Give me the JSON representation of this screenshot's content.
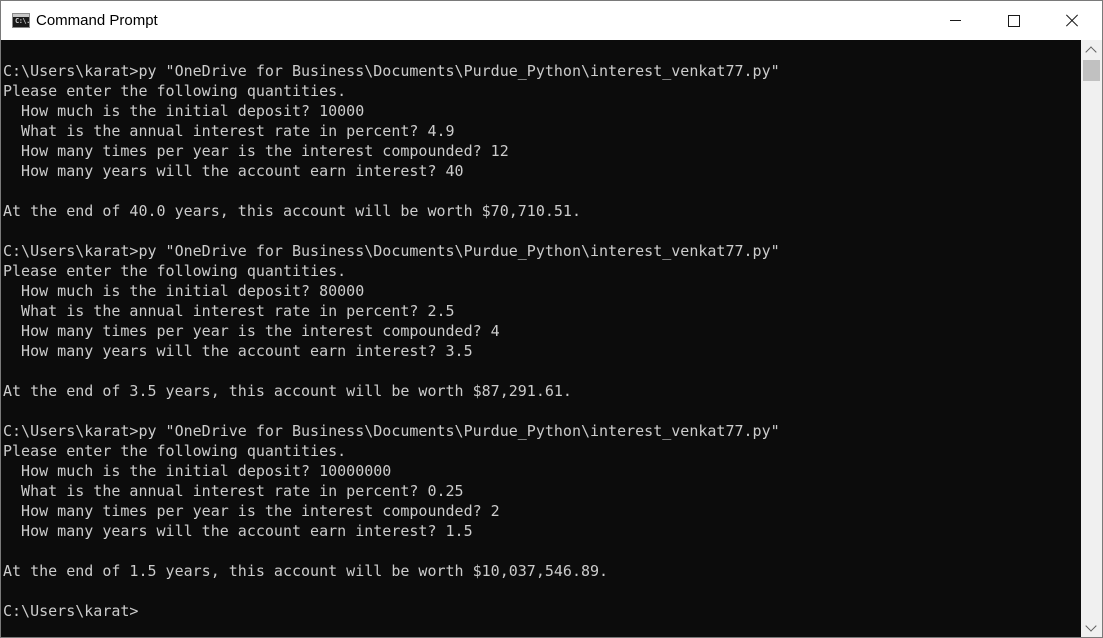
{
  "window": {
    "title": "Command Prompt",
    "icon_name": "cmd-icon",
    "icon_text": "C:\\."
  },
  "console": {
    "text_color": "#cccccc",
    "background_color": "#0c0c0c",
    "lines": [
      "C:\\Users\\karat>py \"OneDrive for Business\\Documents\\Purdue_Python\\interest_venkat77.py\"",
      "Please enter the following quantities.",
      "  How much is the initial deposit? 10000",
      "  What is the annual interest rate in percent? 4.9",
      "  How many times per year is the interest compounded? 12",
      "  How many years will the account earn interest? 40",
      "",
      "At the end of 40.0 years, this account will be worth $70,710.51.",
      "",
      "C:\\Users\\karat>py \"OneDrive for Business\\Documents\\Purdue_Python\\interest_venkat77.py\"",
      "Please enter the following quantities.",
      "  How much is the initial deposit? 80000",
      "  What is the annual interest rate in percent? 2.5",
      "  How many times per year is the interest compounded? 4",
      "  How many years will the account earn interest? 3.5",
      "",
      "At the end of 3.5 years, this account will be worth $87,291.61.",
      "",
      "C:\\Users\\karat>py \"OneDrive for Business\\Documents\\Purdue_Python\\interest_venkat77.py\"",
      "Please enter the following quantities.",
      "  How much is the initial deposit? 10000000",
      "  What is the annual interest rate in percent? 0.25",
      "  How many times per year is the interest compounded? 2",
      "  How many years will the account earn interest? 1.5",
      "",
      "At the end of 1.5 years, this account will be worth $10,037,546.89.",
      "",
      "C:\\Users\\karat>"
    ]
  },
  "titlebar_buttons": {
    "minimize_icon": "minimize-icon",
    "maximize_icon": "maximize-icon",
    "close_icon": "close-icon"
  }
}
